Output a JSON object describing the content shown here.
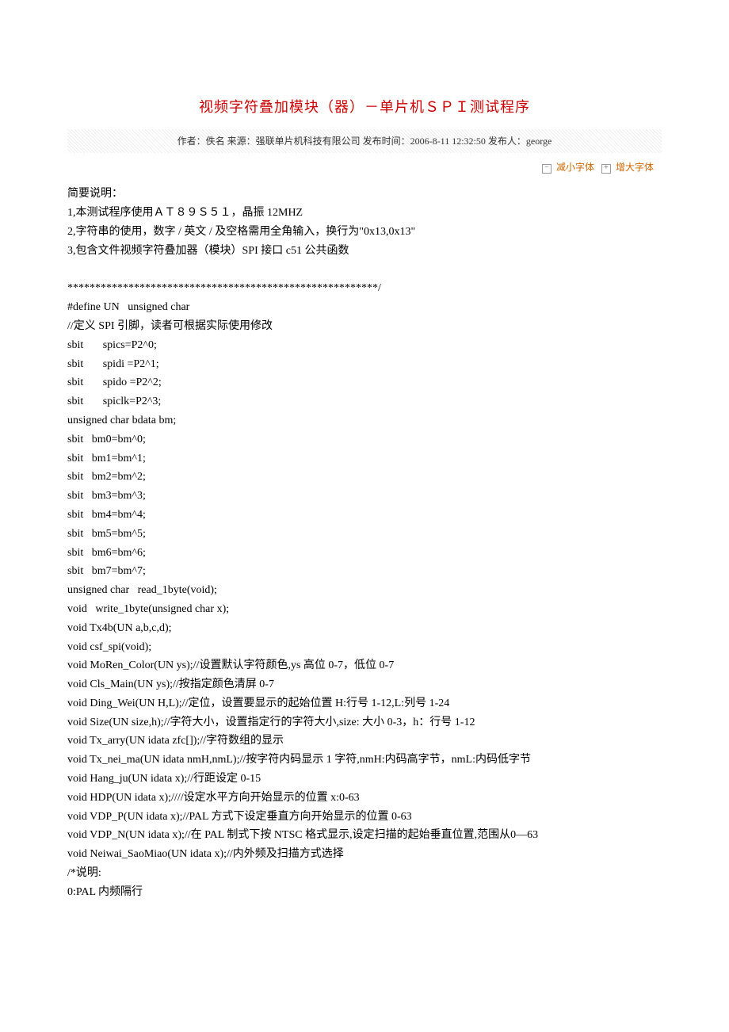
{
  "title": "视频字符叠加模块（器）－单片机ＳＰＩ测试程序",
  "meta": {
    "text": "作者：佚名 来源：强联单片机科技有限公司 发布时间：2006-8-11 12:32:50 发布人：george"
  },
  "fontControl": {
    "decrease": "减小字体",
    "increase": "增大字体"
  },
  "lines": [
    "简要说明：",
    "1,本测试程序使用ＡＴ８９Ｓ５１，晶振 12MHZ",
    "2,字符串的使用，数字 / 英文 / 及空格需用全角输入，换行为\"0x13,0x13\"",
    "3,包含文件视频字符叠加器（模块）SPI 接口 c51 公共函数",
    "",
    "********************************************************/",
    "#define UN   unsigned char",
    "//定义 SPI 引脚，读者可根据实际使用修改",
    "sbit       spics=P2^0;",
    "sbit       spidi =P2^1;",
    "sbit       spido =P2^2;",
    "sbit       spiclk=P2^3;",
    "unsigned char bdata bm;",
    "sbit   bm0=bm^0;",
    "sbit   bm1=bm^1;",
    "sbit   bm2=bm^2;",
    "sbit   bm3=bm^3;",
    "sbit   bm4=bm^4;",
    "sbit   bm5=bm^5;",
    "sbit   bm6=bm^6;",
    "sbit   bm7=bm^7;",
    "unsigned char   read_1byte(void);",
    "void   write_1byte(unsigned char x);",
    "void Tx4b(UN a,b,c,d);",
    "void csf_spi(void);",
    "void MoRen_Color(UN ys);//设置默认字符颜色,ys 高位 0-7，低位 0-7",
    "void Cls_Main(UN ys);//按指定颜色清屏 0-7",
    "void Ding_Wei(UN H,L);//定位，设置要显示的起始位置 H:行号 1-12,L:列号 1-24",
    "void Size(UN size,h);//字符大小，设置指定行的字符大小,size: 大小 0-3，h：行号 1-12",
    "void Tx_arry(UN idata zfc[]);//字符数组的显示",
    "void Tx_nei_ma(UN idata nmH,nmL);//按字符内码显示 1 字符,nmH:内码高字节，nmL:内码低字节",
    "void Hang_ju(UN idata x);//行距设定 0-15",
    "void HDP(UN idata x);////设定水平方向开始显示的位置 x:0-63",
    "void VDP_P(UN idata x);//PAL 方式下设定垂直方向开始显示的位置 0-63",
    "void VDP_N(UN idata x);//在 PAL 制式下按 NTSC 格式显示,设定扫描的起始垂直位置,范围从0—63",
    "void Neiwai_SaoMiao(UN idata x);//内外频及扫描方式选择",
    "/*说明:",
    "0:PAL 内频隔行"
  ]
}
